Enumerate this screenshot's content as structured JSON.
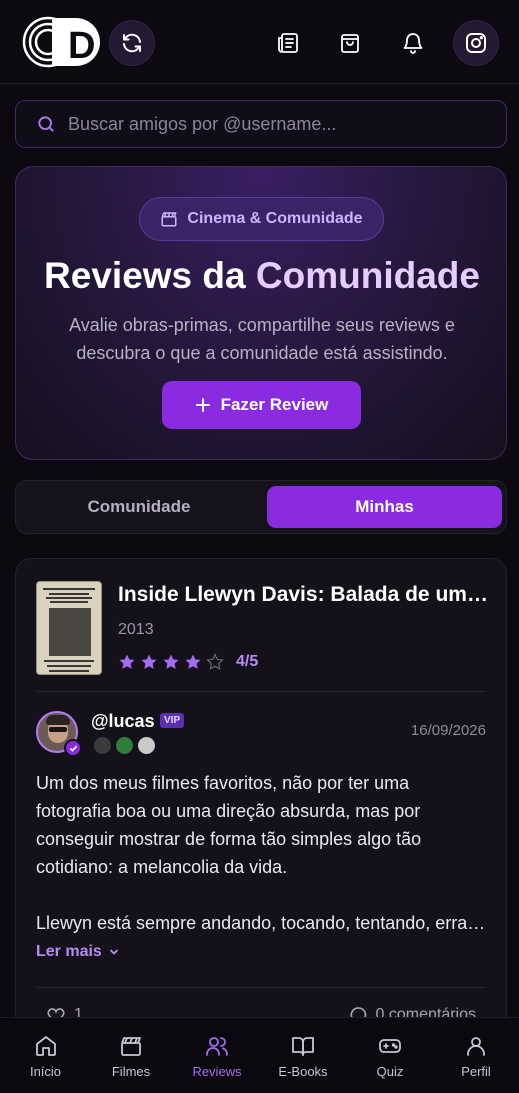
{
  "header": {
    "logo_letter": "D",
    "icons": [
      "refresh-icon",
      "newspaper-icon",
      "shopping-bag-icon",
      "bell-icon",
      "instagram-icon"
    ]
  },
  "search": {
    "placeholder": "Buscar amigos por @username..."
  },
  "hero": {
    "badge": "Cinema & Comunidade",
    "title_part1": "Reviews da ",
    "title_part2": "Comunidade",
    "subtitle": "Avalie obras-primas, compartilhe seus reviews e descubra o que a comunidade está assistindo.",
    "cta": "Fazer Review"
  },
  "tabs": [
    "Comunidade",
    "Minhas"
  ],
  "active_tab": 1,
  "review_card": {
    "movie_title": "Inside Llewyn Davis: Balada de um Homem Comum",
    "year": "2013",
    "stars_filled": 4,
    "stars_total": 5,
    "rating_text": "4/5",
    "username": "@lucas",
    "vip": "VIP",
    "date": "16/09/2026",
    "paragraph1": "Um dos meus filmes favoritos, não por ter uma fotografia boa ou uma direção absurda, mas por conseguir mostrar de forma tão simples algo tão cotidiano: a melancolia da vida.",
    "paragraph2": "Llewyn está sempre andando, tocando, tentando, errando",
    "read_more": "Ler mais",
    "likes": "1",
    "comments": "0 comentários"
  },
  "bottom_nav": [
    {
      "label": "Início",
      "icon": "home-icon"
    },
    {
      "label": "Filmes",
      "icon": "clapperboard-icon"
    },
    {
      "label": "Reviews",
      "icon": "users-icon"
    },
    {
      "label": "E-Books",
      "icon": "book-icon"
    },
    {
      "label": "Quiz",
      "icon": "gamepad-icon"
    },
    {
      "label": "Perfil",
      "icon": "user-icon"
    }
  ],
  "colors": {
    "accent": "#8a2be2",
    "accent_light": "#b98cf5",
    "background": "#0c0a10"
  }
}
